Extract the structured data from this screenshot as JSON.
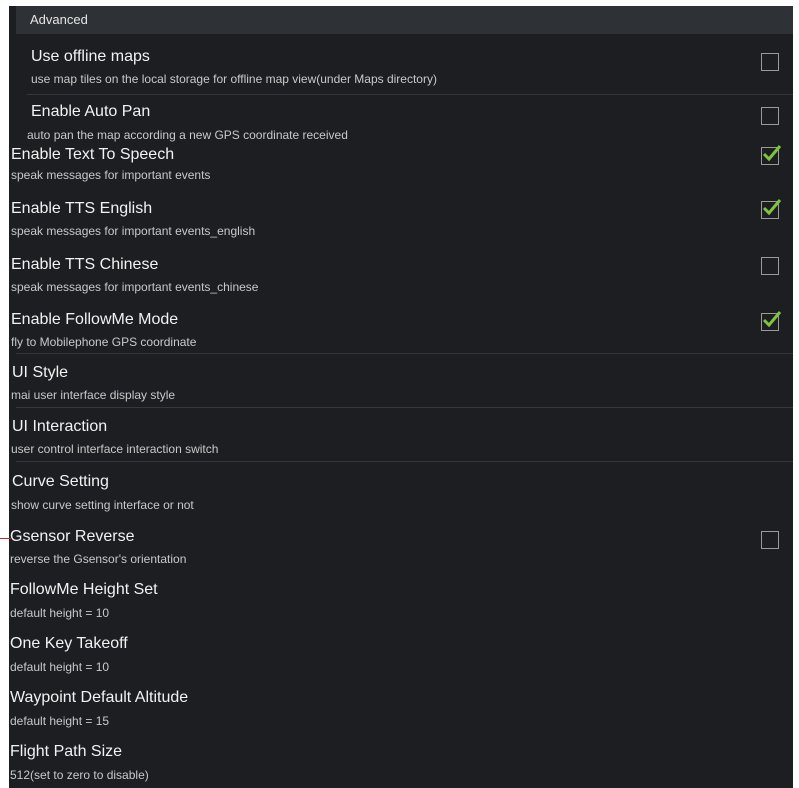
{
  "header": {
    "label": "Advanced"
  },
  "settings": [
    {
      "title": "Use offline maps",
      "summary": "use map tiles on the local storage for offline map view(under Maps directory)",
      "checkbox": true,
      "checked": false
    },
    {
      "title": "Enable Auto Pan",
      "summary": "auto pan the map according a new GPS coordinate received",
      "checkbox": true,
      "checked": false
    },
    {
      "title": "Enable Text To Speech",
      "summary": "speak messages for important events",
      "checkbox": true,
      "checked": true
    },
    {
      "title": "Enable TTS English",
      "summary": "speak messages for important events_english",
      "checkbox": true,
      "checked": true
    },
    {
      "title": "Enable TTS Chinese",
      "summary": "speak messages for important events_chinese",
      "checkbox": true,
      "checked": false
    },
    {
      "title": "Enable FollowMe Mode",
      "summary": "fly to Mobilephone GPS coordinate",
      "checkbox": true,
      "checked": true
    },
    {
      "title": "UI Style",
      "summary": "mai user interface display style",
      "checkbox": false
    },
    {
      "title": "UI Interaction",
      "summary": "user control interface interaction switch",
      "checkbox": false
    },
    {
      "title": "Curve Setting",
      "summary": "show curve setting interface or not",
      "checkbox": false
    },
    {
      "title": "Gsensor Reverse",
      "summary": "reverse the Gsensor's orientation",
      "checkbox": true,
      "checked": false
    },
    {
      "title": "FollowMe Height Set",
      "summary": "default height = 10",
      "checkbox": false
    },
    {
      "title": "One Key Takeoff",
      "summary": "default height = 10",
      "checkbox": false
    },
    {
      "title": "Waypoint Default Altitude",
      "summary": "default height = 15",
      "checkbox": false
    },
    {
      "title": "Flight Path Size",
      "summary": "512(set to zero to disable)",
      "checkbox": false
    }
  ],
  "colors": {
    "background": "#1c1e22",
    "header": "#2e3136",
    "check": "#7cc43c"
  },
  "icons": {
    "checkmark": "checkmark-icon"
  }
}
